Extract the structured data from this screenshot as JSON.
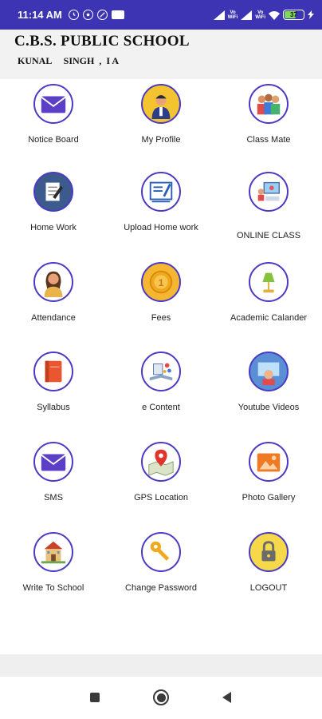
{
  "status_bar": {
    "time": "11:14 AM",
    "vowifi_1": "Vo\nWiFi",
    "vowifi_2": "Vo\nWiFi",
    "battery": "37"
  },
  "header": {
    "school_name": "C.B.S. PUBLIC SCHOOL",
    "student_line": "KUNAL     SINGH  ,  I A"
  },
  "menu": [
    {
      "label": "Notice Board",
      "icon": "envelope-icon"
    },
    {
      "label": "My Profile",
      "icon": "person-icon"
    },
    {
      "label": "Class Mate",
      "icon": "classmates-icon"
    },
    {
      "label": "Home Work",
      "icon": "homework-icon"
    },
    {
      "label": "Upload Home work",
      "icon": "upload-icon"
    },
    {
      "label": "ONLINE CLASS",
      "icon": "online-class-icon"
    },
    {
      "label": "Attendance",
      "icon": "teacher-icon"
    },
    {
      "label": "Fees",
      "icon": "coin-icon"
    },
    {
      "label": "Academic Calander",
      "icon": "lamp-icon"
    },
    {
      "label": "Syllabus",
      "icon": "book-icon"
    },
    {
      "label": "e Content",
      "icon": "econtent-icon"
    },
    {
      "label": "Youtube Videos",
      "icon": "video-icon"
    },
    {
      "label": "SMS",
      "icon": "sms-envelope-icon"
    },
    {
      "label": "GPS Location",
      "icon": "map-pin-icon"
    },
    {
      "label": "Photo Gallery",
      "icon": "gallery-icon"
    },
    {
      "label": "Write To School",
      "icon": "school-building-icon"
    },
    {
      "label": "Change Password",
      "icon": "key-icon"
    },
    {
      "label": "LOGOUT",
      "icon": "lock-icon"
    }
  ],
  "colors": {
    "status_bar": "#3d34b4",
    "icon_ring": "#4a3bc4",
    "header_bg": "#f2f2f2"
  }
}
